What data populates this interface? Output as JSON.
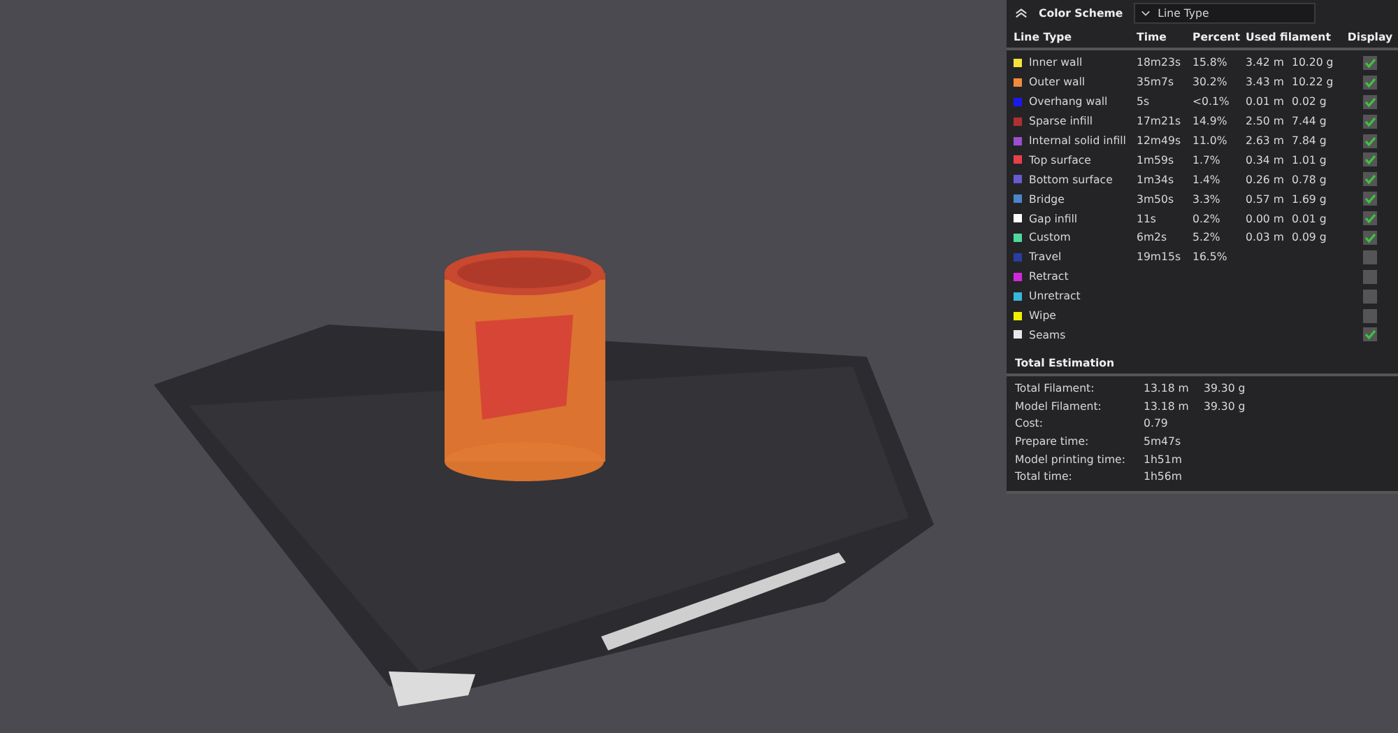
{
  "panel": {
    "title": "Color Scheme",
    "scheme": {
      "value": "Line Type"
    },
    "columns": [
      "Line Type",
      "Time",
      "Percent",
      "Used filament",
      "Display"
    ],
    "rows": [
      {
        "name": "Inner wall",
        "color": "#f5e33a",
        "time": "18m23s",
        "percent": "15.8%",
        "length": "3.42 m",
        "weight": "10.20 g",
        "checked": true
      },
      {
        "name": "Outer wall",
        "color": "#f08a3c",
        "time": "35m7s",
        "percent": "30.2%",
        "length": "3.43 m",
        "weight": "10.22 g",
        "checked": true
      },
      {
        "name": "Overhang wall",
        "color": "#1a1af0",
        "time": "5s",
        "percent": "<0.1%",
        "length": "0.01 m",
        "weight": "0.02 g",
        "checked": true
      },
      {
        "name": "Sparse infill",
        "color": "#b03030",
        "time": "17m21s",
        "percent": "14.9%",
        "length": "2.50 m",
        "weight": "7.44 g",
        "checked": true
      },
      {
        "name": "Internal solid infill",
        "color": "#9a4fd0",
        "time": "12m49s",
        "percent": "11.0%",
        "length": "2.63 m",
        "weight": "7.84 g",
        "checked": true
      },
      {
        "name": "Top surface",
        "color": "#e8404a",
        "time": "1m59s",
        "percent": "1.7%",
        "length": "0.34 m",
        "weight": "1.01 g",
        "checked": true
      },
      {
        "name": "Bottom surface",
        "color": "#6a5ad0",
        "time": "1m34s",
        "percent": "1.4%",
        "length": "0.26 m",
        "weight": "0.78 g",
        "checked": true
      },
      {
        "name": "Bridge",
        "color": "#4a86c8",
        "time": "3m50s",
        "percent": "3.3%",
        "length": "0.57 m",
        "weight": "1.69 g",
        "checked": true
      },
      {
        "name": "Gap infill",
        "color": "#ffffff",
        "time": "11s",
        "percent": "0.2%",
        "length": "0.00 m",
        "weight": "0.01 g",
        "checked": true
      },
      {
        "name": "Custom",
        "color": "#4ed8a0",
        "time": "6m2s",
        "percent": "5.2%",
        "length": "0.03 m",
        "weight": "0.09 g",
        "checked": true
      },
      {
        "name": "Travel",
        "color": "#2a3ea0",
        "time": "19m15s",
        "percent": "16.5%",
        "checked": false
      },
      {
        "name": "Retract",
        "color": "#d02ad8",
        "checked": false
      },
      {
        "name": "Unretract",
        "color": "#3ab8d8",
        "checked": false
      },
      {
        "name": "Wipe",
        "color": "#f0f000",
        "checked": false
      },
      {
        "name": "Seams",
        "color": "#e8e8e8",
        "checked": true
      }
    ],
    "estimation": {
      "title": "Total Estimation",
      "items": [
        {
          "label": "Total Filament:",
          "values": [
            "13.18 m",
            "39.30 g"
          ]
        },
        {
          "label": "Model Filament:",
          "values": [
            "13.18 m",
            "39.30 g"
          ]
        },
        {
          "label": "Cost:",
          "values": [
            "0.79"
          ]
        },
        {
          "label": "Prepare time:",
          "values": [
            "5m47s"
          ]
        },
        {
          "label": "Model printing time:",
          "values": [
            "1h51m"
          ]
        },
        {
          "label": "Total time:",
          "values": [
            "1h56m"
          ]
        }
      ]
    }
  }
}
